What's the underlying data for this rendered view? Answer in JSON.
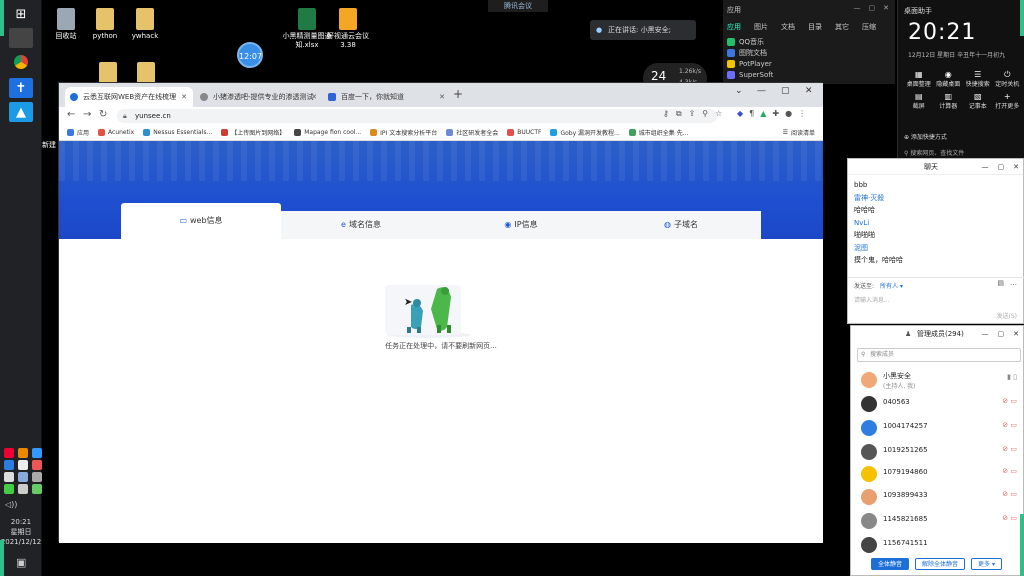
{
  "desktop": {
    "icons": [
      {
        "label": "回收站",
        "color": "#9aa7b5"
      },
      {
        "label": "python",
        "color": "#e6c36a"
      },
      {
        "label": "ywhack",
        "color": "#e6c36a"
      },
      {
        "label": "小黑精测量图通知.xlsx",
        "color": "#1f7a43"
      },
      {
        "label": "好视通云会议 3.38",
        "color": "#f4a624"
      }
    ],
    "badge": "12:07",
    "edge_label": "新建"
  },
  "meeting_bar": {
    "label": "腾讯会议"
  },
  "speaking": {
    "text": "正在讲话: 小黑安全;"
  },
  "speed": {
    "big": "24",
    "up": "1.26k/s",
    "down": "4.3k/s"
  },
  "appmenu": {
    "title": "应用",
    "tabs": [
      "应用",
      "图片",
      "文档",
      "目录",
      "其它",
      "压缩"
    ],
    "items": [
      {
        "label": "QQ音乐",
        "color": "#22c069"
      },
      {
        "label": "图院文档",
        "color": "#3b79e0"
      },
      {
        "label": "PotPlayer",
        "color": "#f2c400"
      },
      {
        "label": "SuperSoft",
        "color": "#6d6dff"
      }
    ]
  },
  "clock_panel": {
    "title": "桌面助手",
    "time": "20:21",
    "date": "12月12日   星期日   辛丑年十一月初九",
    "buttons": [
      {
        "icon": "▦",
        "label": "桌面整理"
      },
      {
        "icon": "◉",
        "label": "隐藏桌面"
      },
      {
        "icon": "☰",
        "label": "快捷搜索"
      },
      {
        "icon": "⏻",
        "label": "定时关机"
      },
      {
        "icon": "▤",
        "label": "截屏"
      },
      {
        "icon": "▥",
        "label": "计算器"
      },
      {
        "icon": "▧",
        "label": "记事本"
      },
      {
        "icon": "+",
        "label": "打开更多"
      }
    ],
    "more": "⊕ 添加快捷方式",
    "search": "⚲ 搜索网页、查找文件"
  },
  "taskbar": {
    "clock_time": "20:21",
    "clock_day": "星期日",
    "clock_date": "2021/12/12",
    "volume": "◁))"
  },
  "browser": {
    "tabs": [
      {
        "title": "云悉互联网WEB资产在线梳理",
        "favicon": "#1d6fd8",
        "active": true
      },
      {
        "title": "小猪渗透吧-提供专业的渗透测试",
        "favicon": "#888888",
        "active": false
      },
      {
        "title": "百度一下，你就知道",
        "favicon": "#3062d9",
        "active": false
      }
    ],
    "url": "yunsee.cn",
    "bookmarks": [
      {
        "label": "应用",
        "color": "#3b79e0"
      },
      {
        "label": "Acunetix",
        "color": "#e2533f"
      },
      {
        "label": "Nessus Essentials...",
        "color": "#2a8fd0"
      },
      {
        "label": "【上传图片到网络】",
        "color": "#d23b2f"
      },
      {
        "label": "Mapage fion cool...",
        "color": "#444444"
      },
      {
        "label": "IPI 文本搜索分析平台",
        "color": "#d98c1e"
      },
      {
        "label": "社区研发者全会",
        "color": "#6b8bd6"
      },
      {
        "label": "BUUCTF",
        "color": "#e34f4f"
      },
      {
        "label": "Goby 漏洞开发教程...",
        "color": "#1d9fe0"
      },
      {
        "label": "城市组织全集 先...",
        "color": "#3fa15b"
      }
    ],
    "reading_list": "阅读清单"
  },
  "page": {
    "tabs": [
      {
        "icon": "▭",
        "label": "web信息",
        "active": true
      },
      {
        "icon": "e",
        "label": "域名信息",
        "active": false
      },
      {
        "icon": "◉",
        "label": "IP信息",
        "active": false
      },
      {
        "icon": "◍",
        "label": "子域名",
        "active": false
      }
    ],
    "loading_text": "任务正在处理中，请不要刷新网页..."
  },
  "chat": {
    "title": "聊天",
    "messages": [
      {
        "type": "text",
        "text": "bbb"
      },
      {
        "type": "name",
        "text": "雷神·灭殺"
      },
      {
        "type": "text",
        "text": "哈哈哈"
      },
      {
        "type": "name",
        "text": "NvLi"
      },
      {
        "type": "text",
        "text": "啪啪啪"
      },
      {
        "type": "name",
        "text": "泥图"
      },
      {
        "type": "text",
        "text": "摸个鬼，哈哈哈"
      }
    ],
    "to_label": "发送至:",
    "to_value": "所有人 ▾",
    "placeholder": "请输入消息...",
    "send": "发送(S)"
  },
  "members": {
    "title": "管理成员(294)",
    "search_placeholder": "搜索成员",
    "rows": [
      {
        "name": "小黑安全",
        "sub": "(主持人, 我)",
        "color": "#f0a878"
      },
      {
        "name": "040563",
        "sub": "",
        "color": "#333333"
      },
      {
        "name": "1004174257",
        "sub": "",
        "color": "#2f7de0"
      },
      {
        "name": "1019251265",
        "sub": "",
        "color": "#555555"
      },
      {
        "name": "1079194860",
        "sub": "",
        "color": "#f6c200"
      },
      {
        "name": "1093899433",
        "sub": "",
        "color": "#e8a070"
      },
      {
        "name": "1145821685",
        "sub": "",
        "color": "#888888"
      },
      {
        "name": "1156741511",
        "sub": "",
        "color": "#444444"
      }
    ],
    "buttons": [
      "全体静音",
      "解除全体静音",
      "更多 ▾"
    ]
  }
}
